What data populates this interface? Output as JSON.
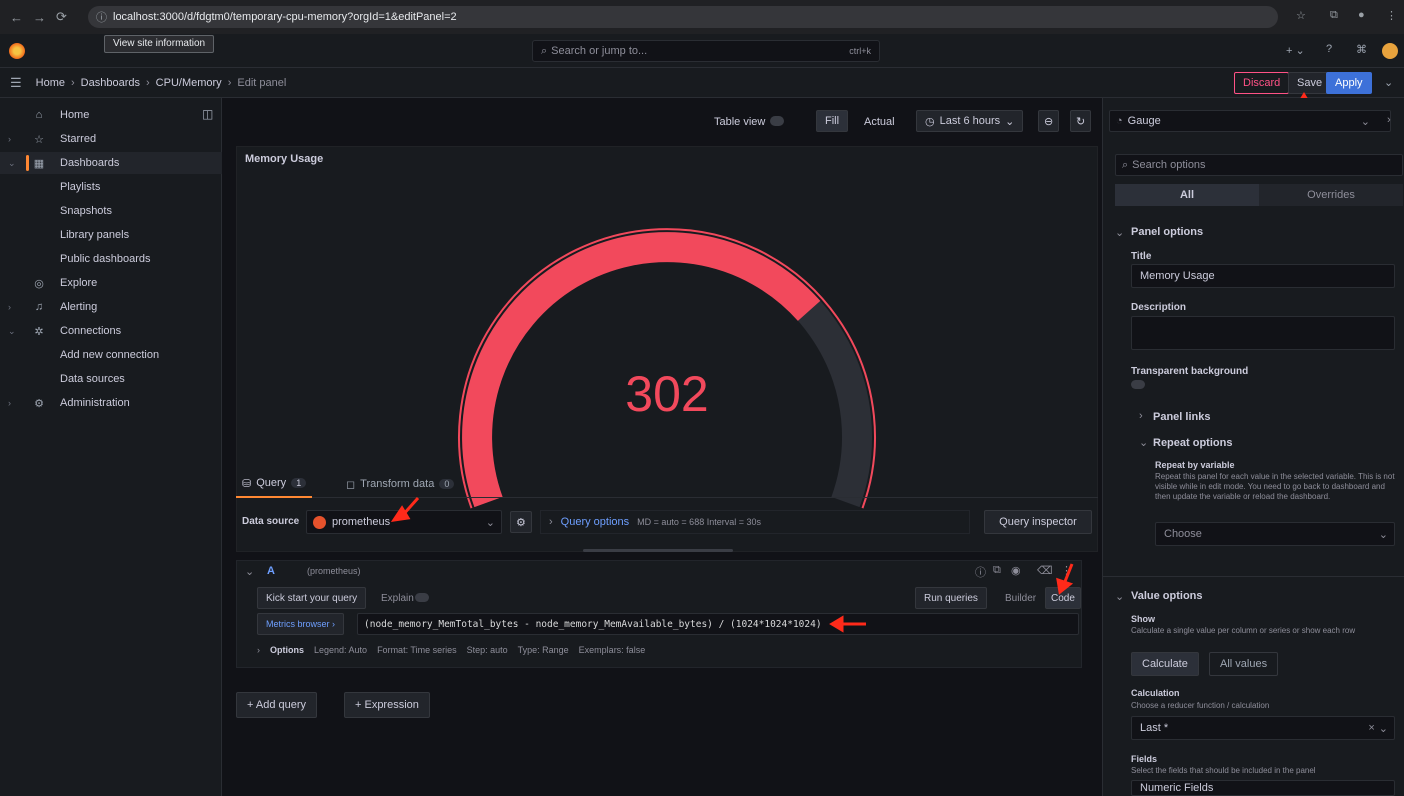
{
  "browser": {
    "url": "localhost:3000/d/fdgtm0/temporary-cpu-memory?orgId=1&editPanel=2",
    "tooltip": "View site information",
    "nav": [
      "←",
      "→",
      "⟳"
    ]
  },
  "topbar": {
    "search_placeholder": "Search or jump to...",
    "search_shortcut": "ctrl+k"
  },
  "breadcrumb": {
    "items": [
      "Home",
      "Dashboards",
      "CPU/Memory",
      "Edit panel"
    ],
    "sep": "›"
  },
  "toolbar": {
    "discard_label": "Discard",
    "save_label": "Save",
    "apply_label": "Apply"
  },
  "sidebar": {
    "items": [
      {
        "label": "Home",
        "icon": "home-icon",
        "glyph": "⌂",
        "caret": ""
      },
      {
        "label": "Starred",
        "icon": "star-icon",
        "glyph": "☆",
        "caret": "›"
      },
      {
        "label": "Dashboards",
        "icon": "dashboards-icon",
        "glyph": "▦",
        "caret": "⌄"
      },
      {
        "label": "Playlists",
        "icon": "",
        "glyph": "",
        "caret": ""
      },
      {
        "label": "Snapshots",
        "icon": "",
        "glyph": "",
        "caret": ""
      },
      {
        "label": "Library panels",
        "icon": "",
        "glyph": "",
        "caret": ""
      },
      {
        "label": "Public dashboards",
        "icon": "",
        "glyph": "",
        "caret": ""
      },
      {
        "label": "Explore",
        "icon": "explore-icon",
        "glyph": "◎",
        "caret": ""
      },
      {
        "label": "Alerting",
        "icon": "bell-icon",
        "glyph": "♫",
        "caret": "›"
      },
      {
        "label": "Connections",
        "icon": "connections-icon",
        "glyph": "✲",
        "caret": "⌄"
      },
      {
        "label": "Add new connection",
        "icon": "",
        "glyph": "",
        "caret": ""
      },
      {
        "label": "Data sources",
        "icon": "",
        "glyph": "",
        "caret": ""
      },
      {
        "label": "Administration",
        "icon": "gear-icon",
        "glyph": "⚙",
        "caret": "›"
      }
    ]
  },
  "panel_toolbar": {
    "table_view": "Table view",
    "fill": "Fill",
    "actual": "Actual",
    "time_range": "Last 6 hours"
  },
  "panel": {
    "title": "Memory Usage",
    "value": "302",
    "gauge_fraction": 0.72,
    "color": "#f2495c"
  },
  "query_tabs": {
    "query": "Query",
    "query_count": "1",
    "transform": "Transform data",
    "transform_count": "0"
  },
  "datasource": {
    "label": "Data source",
    "name": "prometheus",
    "options_label": "Query options",
    "options_meta": "MD = auto = 688   Interval = 30s",
    "inspector": "Query inspector"
  },
  "query": {
    "ref": "A",
    "ds": "(prometheus)",
    "kick_start": "Kick start your query",
    "explain": "Explain",
    "run": "Run queries",
    "builder": "Builder",
    "code": "Code",
    "metrics_browser": "Metrics browser ›",
    "expr": "(node_memory_MemTotal_bytes - node_memory_MemAvailable_bytes) / (1024*1024*1024)",
    "options": [
      "Options",
      "Legend: Auto",
      "Format: Time series",
      "Step: auto",
      "Type: Range",
      "Exemplars: false"
    ]
  },
  "add_query": "+ Add query",
  "add_expression": "+ Expression",
  "options_pane": {
    "viz": "Gauge",
    "search_placeholder": "Search options",
    "tab_all": "All",
    "tab_overrides": "Overrides",
    "panel_options": "Panel options",
    "title_label": "Title",
    "title_value": "Memory Usage",
    "description_label": "Description",
    "transparent_label": "Transparent background",
    "panel_links": "Panel links",
    "repeat_options": "Repeat options",
    "repeat_by": "Repeat by variable",
    "repeat_help": "Repeat this panel for each value in the selected variable. This is not visible while in edit mode. You need to go back to dashboard and then update the variable or reload the dashboard.",
    "choose": "Choose",
    "value_options": "Value options",
    "show_label": "Show",
    "show_help": "Calculate a single value per column or series or show each row",
    "calculate": "Calculate",
    "all_values": "All values",
    "calculation_label": "Calculation",
    "calculation_help": "Choose a reducer function / calculation",
    "calculation_value": "Last *",
    "fields_label": "Fields",
    "fields_help": "Select the fields that should be included in the panel",
    "fields_value": "Numeric Fields"
  },
  "colors": {
    "accent": "#3d71d9",
    "gauge": "#f2495c",
    "annotation": "#ff2a1a",
    "brand": "#ff8833"
  }
}
